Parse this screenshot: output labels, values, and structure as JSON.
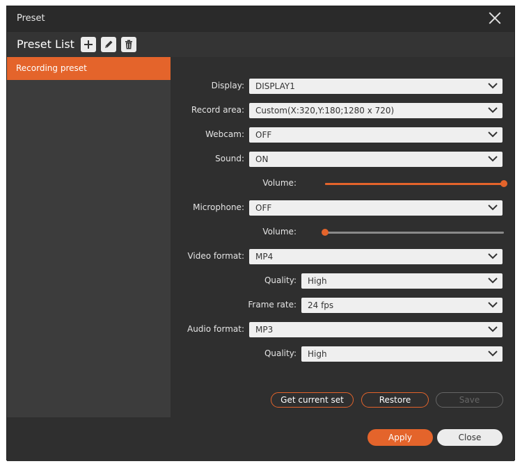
{
  "window": {
    "title": "Preset"
  },
  "preset_list": {
    "title": "Preset List",
    "items": [
      "Recording preset"
    ]
  },
  "icons": {
    "add": "plus-icon",
    "edit": "pencil-icon",
    "delete": "trash-icon",
    "close": "close-icon",
    "dropdown": "chevron-down-icon"
  },
  "fields": {
    "display": {
      "label": "Display:",
      "value": "DISPLAY1"
    },
    "record_area": {
      "label": "Record area:",
      "value": "Custom(X:320,Y:180;1280 x 720)"
    },
    "webcam": {
      "label": "Webcam:",
      "value": "OFF"
    },
    "sound": {
      "label": "Sound:",
      "value": "ON"
    },
    "sound_volume": {
      "label": "Volume:",
      "level": 1.0
    },
    "microphone": {
      "label": "Microphone:",
      "value": "OFF"
    },
    "mic_volume": {
      "label": "Volume:",
      "level": 0.0
    },
    "video_format": {
      "label": "Video format:",
      "value": "MP4"
    },
    "video_quality": {
      "label": "Quality:",
      "value": "High"
    },
    "frame_rate": {
      "label": "Frame rate:",
      "value": "24 fps"
    },
    "audio_format": {
      "label": "Audio format:",
      "value": "MP3"
    },
    "audio_quality": {
      "label": "Quality:",
      "value": "High"
    }
  },
  "actions": {
    "get_current": "Get current set",
    "restore": "Restore",
    "save": "Save"
  },
  "footer": {
    "apply": "Apply",
    "close": "Close"
  },
  "colors": {
    "accent": "#e4642b",
    "background": "#2f2f2f",
    "sidebar": "#3c3c3c"
  }
}
